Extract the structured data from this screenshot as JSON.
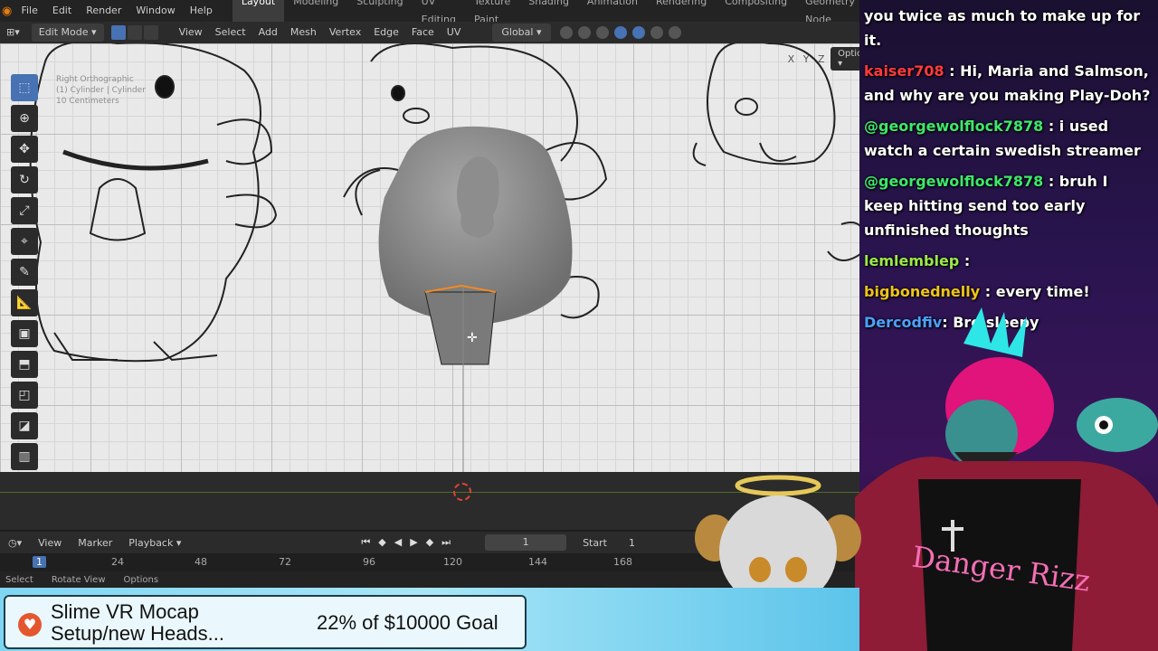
{
  "topbar": {
    "menus": [
      "File",
      "Edit",
      "Render",
      "Window",
      "Help"
    ],
    "workspaces": [
      "Layout",
      "Modeling",
      "Sculpting",
      "UV Editing",
      "Texture Paint",
      "Shading",
      "Animation",
      "Rendering",
      "Compositing",
      "Geometry Node"
    ],
    "active_workspace": "Layout"
  },
  "header": {
    "mode": "Edit Mode",
    "menus": [
      "View",
      "Select",
      "Add",
      "Mesh",
      "Vertex",
      "Edge",
      "Face",
      "UV"
    ],
    "orientation": "Global"
  },
  "viewport": {
    "view_name": "Right Orthographic",
    "object": "(1) Cylinder | Cylinder",
    "scale": "10 Centimeters",
    "options_label": "Options",
    "axes": [
      "X",
      "Y",
      "Z"
    ]
  },
  "timeline": {
    "menus": [
      "View",
      "Marker",
      "Playback"
    ],
    "current_frame": "1",
    "start_label": "Start",
    "start_value": "1",
    "ruler": [
      "1",
      "24",
      "48",
      "72",
      "96",
      "120",
      "144",
      "168"
    ]
  },
  "statusbar": {
    "items": [
      "Select",
      "Rotate View",
      "Options"
    ]
  },
  "chat": {
    "messages": [
      {
        "user": "",
        "text": "you twice as much to make up for it.",
        "color": "#ffffff"
      },
      {
        "user": "kaiser708",
        "text": " : Hi, Maria and Salmson, and why are you making Play-Doh?",
        "color": "#ff3b3b"
      },
      {
        "user": "@georgewolflock7878",
        "text": " : i used watch a certain swedish streamer",
        "color": "#3ee86a"
      },
      {
        "user": "@georgewolflock7878",
        "text": " : bruh I keep hitting send too early unfinished thoughts",
        "color": "#3ee86a"
      },
      {
        "user": "lemlemblep",
        "text": " :",
        "color": "#9be84a"
      },
      {
        "user": "bigbonednelly",
        "text": " : every time!",
        "color": "#f0c419"
      },
      {
        "user": "Dercodfiv",
        "text": ": Bro sleepy",
        "color": "#4aa3ff"
      }
    ]
  },
  "banner": {
    "title_line1": "Slime VR Mocap",
    "title_line2": "Setup/new Heads...",
    "goal_text": "22% of $10000 Goal"
  },
  "avatar": {
    "shirt_text": "Danger Rizz"
  },
  "colors": {
    "blender_blue": "#4772b3",
    "blender_orange": "#e87d0d"
  }
}
